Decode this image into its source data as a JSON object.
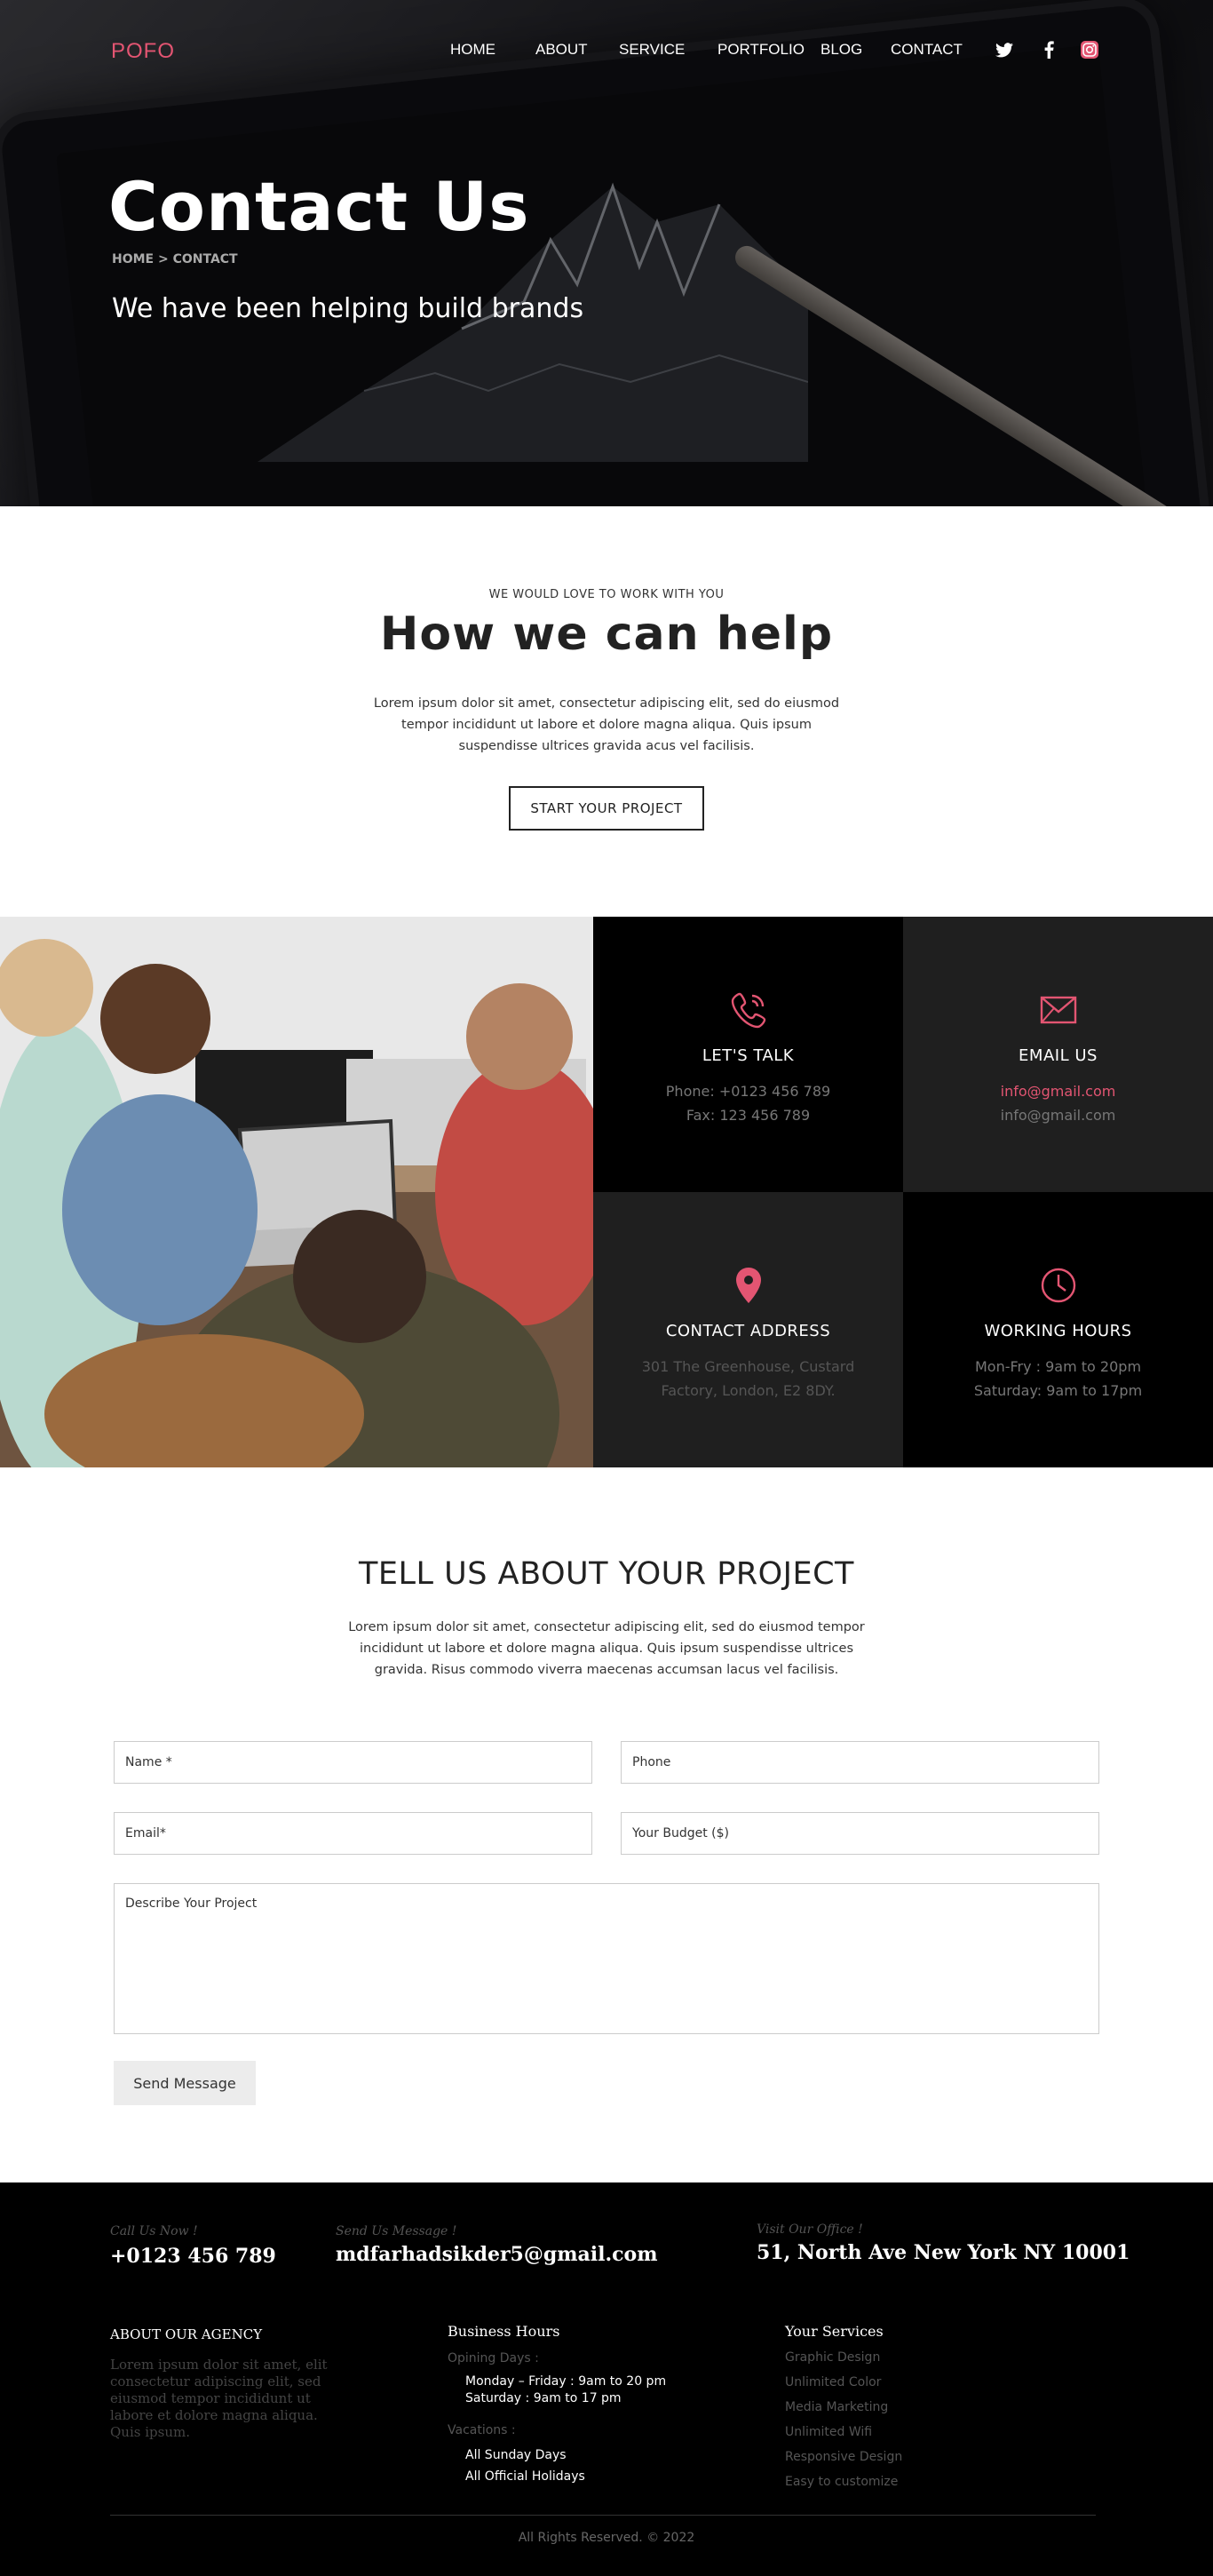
{
  "brand": {
    "logo": "POFO",
    "accent": "#e35572"
  },
  "nav": {
    "items": [
      "HOME",
      "ABOUT",
      "SERVICE",
      "PORTFOLIO",
      "BLOG",
      "CONTACT"
    ],
    "social": [
      "twitter-icon",
      "facebook-icon",
      "instagram-icon"
    ]
  },
  "hero": {
    "title": "Contact Us",
    "breadcrumb": "HOME > CONTACT",
    "subtitle": "We have been helping build brands"
  },
  "help": {
    "kicker": "WE WOULD LOVE TO WORK WITH YOU",
    "title": "How we can help",
    "text": "Lorem ipsum dolor sit amet, consectetur adipiscing elit, sed do eiusmod tempor incididunt ut labore et dolore magna aliqua. Quis ipsum suspendisse ultrices gravida acus vel facilisis.",
    "button": "START YOUR PROJECT"
  },
  "contact_cards": [
    {
      "icon": "phone-icon",
      "title": "LET'S TALK",
      "line1": "Phone:  +0123 456 789",
      "line2": "Fax: 123 456 789"
    },
    {
      "icon": "envelope-icon",
      "title": "EMAIL US",
      "line1": "info@gmail.com",
      "line2": "info@gmail.com"
    },
    {
      "icon": "map-pin-icon",
      "title": "CONTACT ADDRESS",
      "line1": "301 The Greenhouse, Custard",
      "line2": "Factory, London, E2 8DY."
    },
    {
      "icon": "clock-icon",
      "title": "WORKING HOURS",
      "line1": "Mon-Fry : 9am to 20pm",
      "line2": "Saturday: 9am to 17pm"
    }
  ],
  "project": {
    "title": "TELL US ABOUT YOUR PROJECT",
    "text": "Lorem ipsum dolor sit amet, consectetur adipiscing elit, sed do eiusmod tempor incididunt ut labore et dolore magna aliqua. Quis ipsum suspendisse ultrices gravida. Risus commodo viverra maecenas accumsan lacus vel facilisis.",
    "fields": {
      "name": "Name *",
      "phone": "Phone",
      "email": "Email*",
      "budget": "Your Budget ($)",
      "describe": "Describe Your Project"
    },
    "submit": "Send Message"
  },
  "footer": {
    "call_label": "Call Us Now !",
    "call_value": "+0123 456 789",
    "mail_label": "Send Us Message !",
    "mail_value": "mdfarhadsikder5@gmail.com",
    "visit_label": "Visit Our Office !",
    "visit_value": "51, North Ave New York NY 10001",
    "about_title": "ABOUT OUR AGENCY",
    "about_text": "Lorem ipsum dolor sit amet, elit consectetur adipiscing elit, sed eiusmod tempor incididunt ut labore et dolore magna aliqua. Quis ipsum.",
    "hours_title": "Business Hours",
    "opening_label": "Opining Days :",
    "opening_1": "Monday – Friday : 9am to 20 pm",
    "opening_2": "Saturday : 9am to 17 pm",
    "vacations_label": "Vacations :",
    "vacation_1": "All Sunday Days",
    "vacation_2": "All Official Holidays",
    "services_title": "Your  Services",
    "services": [
      "Graphic Design",
      "Unlimited Color",
      "Media Marketing",
      "Unlimited Wifi",
      "Responsive Design",
      "Easy to customize"
    ],
    "copyright": "All Rights Reserved. © 2022"
  }
}
